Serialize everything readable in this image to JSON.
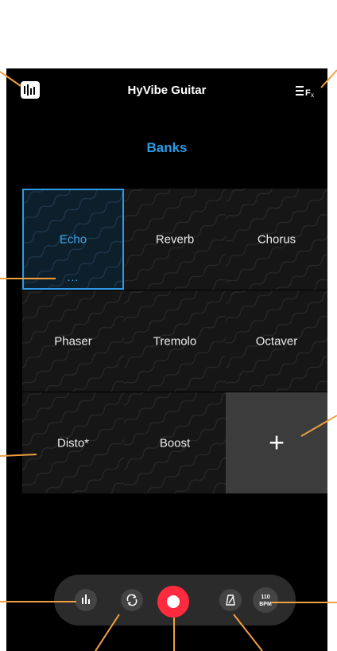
{
  "app": {
    "title": "HyVibe Guitar"
  },
  "icons": {
    "app_icon": "equalizer-app-icon",
    "fx_icon": "fx-list-icon",
    "levels": "level-bars-icon",
    "loop": "loop-icon",
    "record": "record-icon",
    "metronome": "metronome-icon"
  },
  "section": {
    "title": "Banks"
  },
  "banks": [
    {
      "label": "Echo",
      "selected": true,
      "more": "..."
    },
    {
      "label": "Reverb"
    },
    {
      "label": "Chorus"
    },
    {
      "label": "Phaser"
    },
    {
      "label": "Tremolo"
    },
    {
      "label": "Octaver"
    },
    {
      "label": "Disto*"
    },
    {
      "label": "Boost"
    }
  ],
  "add_bank": {
    "label": "+"
  },
  "transport": {
    "tempo_value": "110",
    "tempo_unit": "BPM"
  },
  "colors": {
    "accent": "#2e9ae6",
    "record": "#ff2a3d",
    "annotation": "#f0a040",
    "background": "#000000"
  }
}
